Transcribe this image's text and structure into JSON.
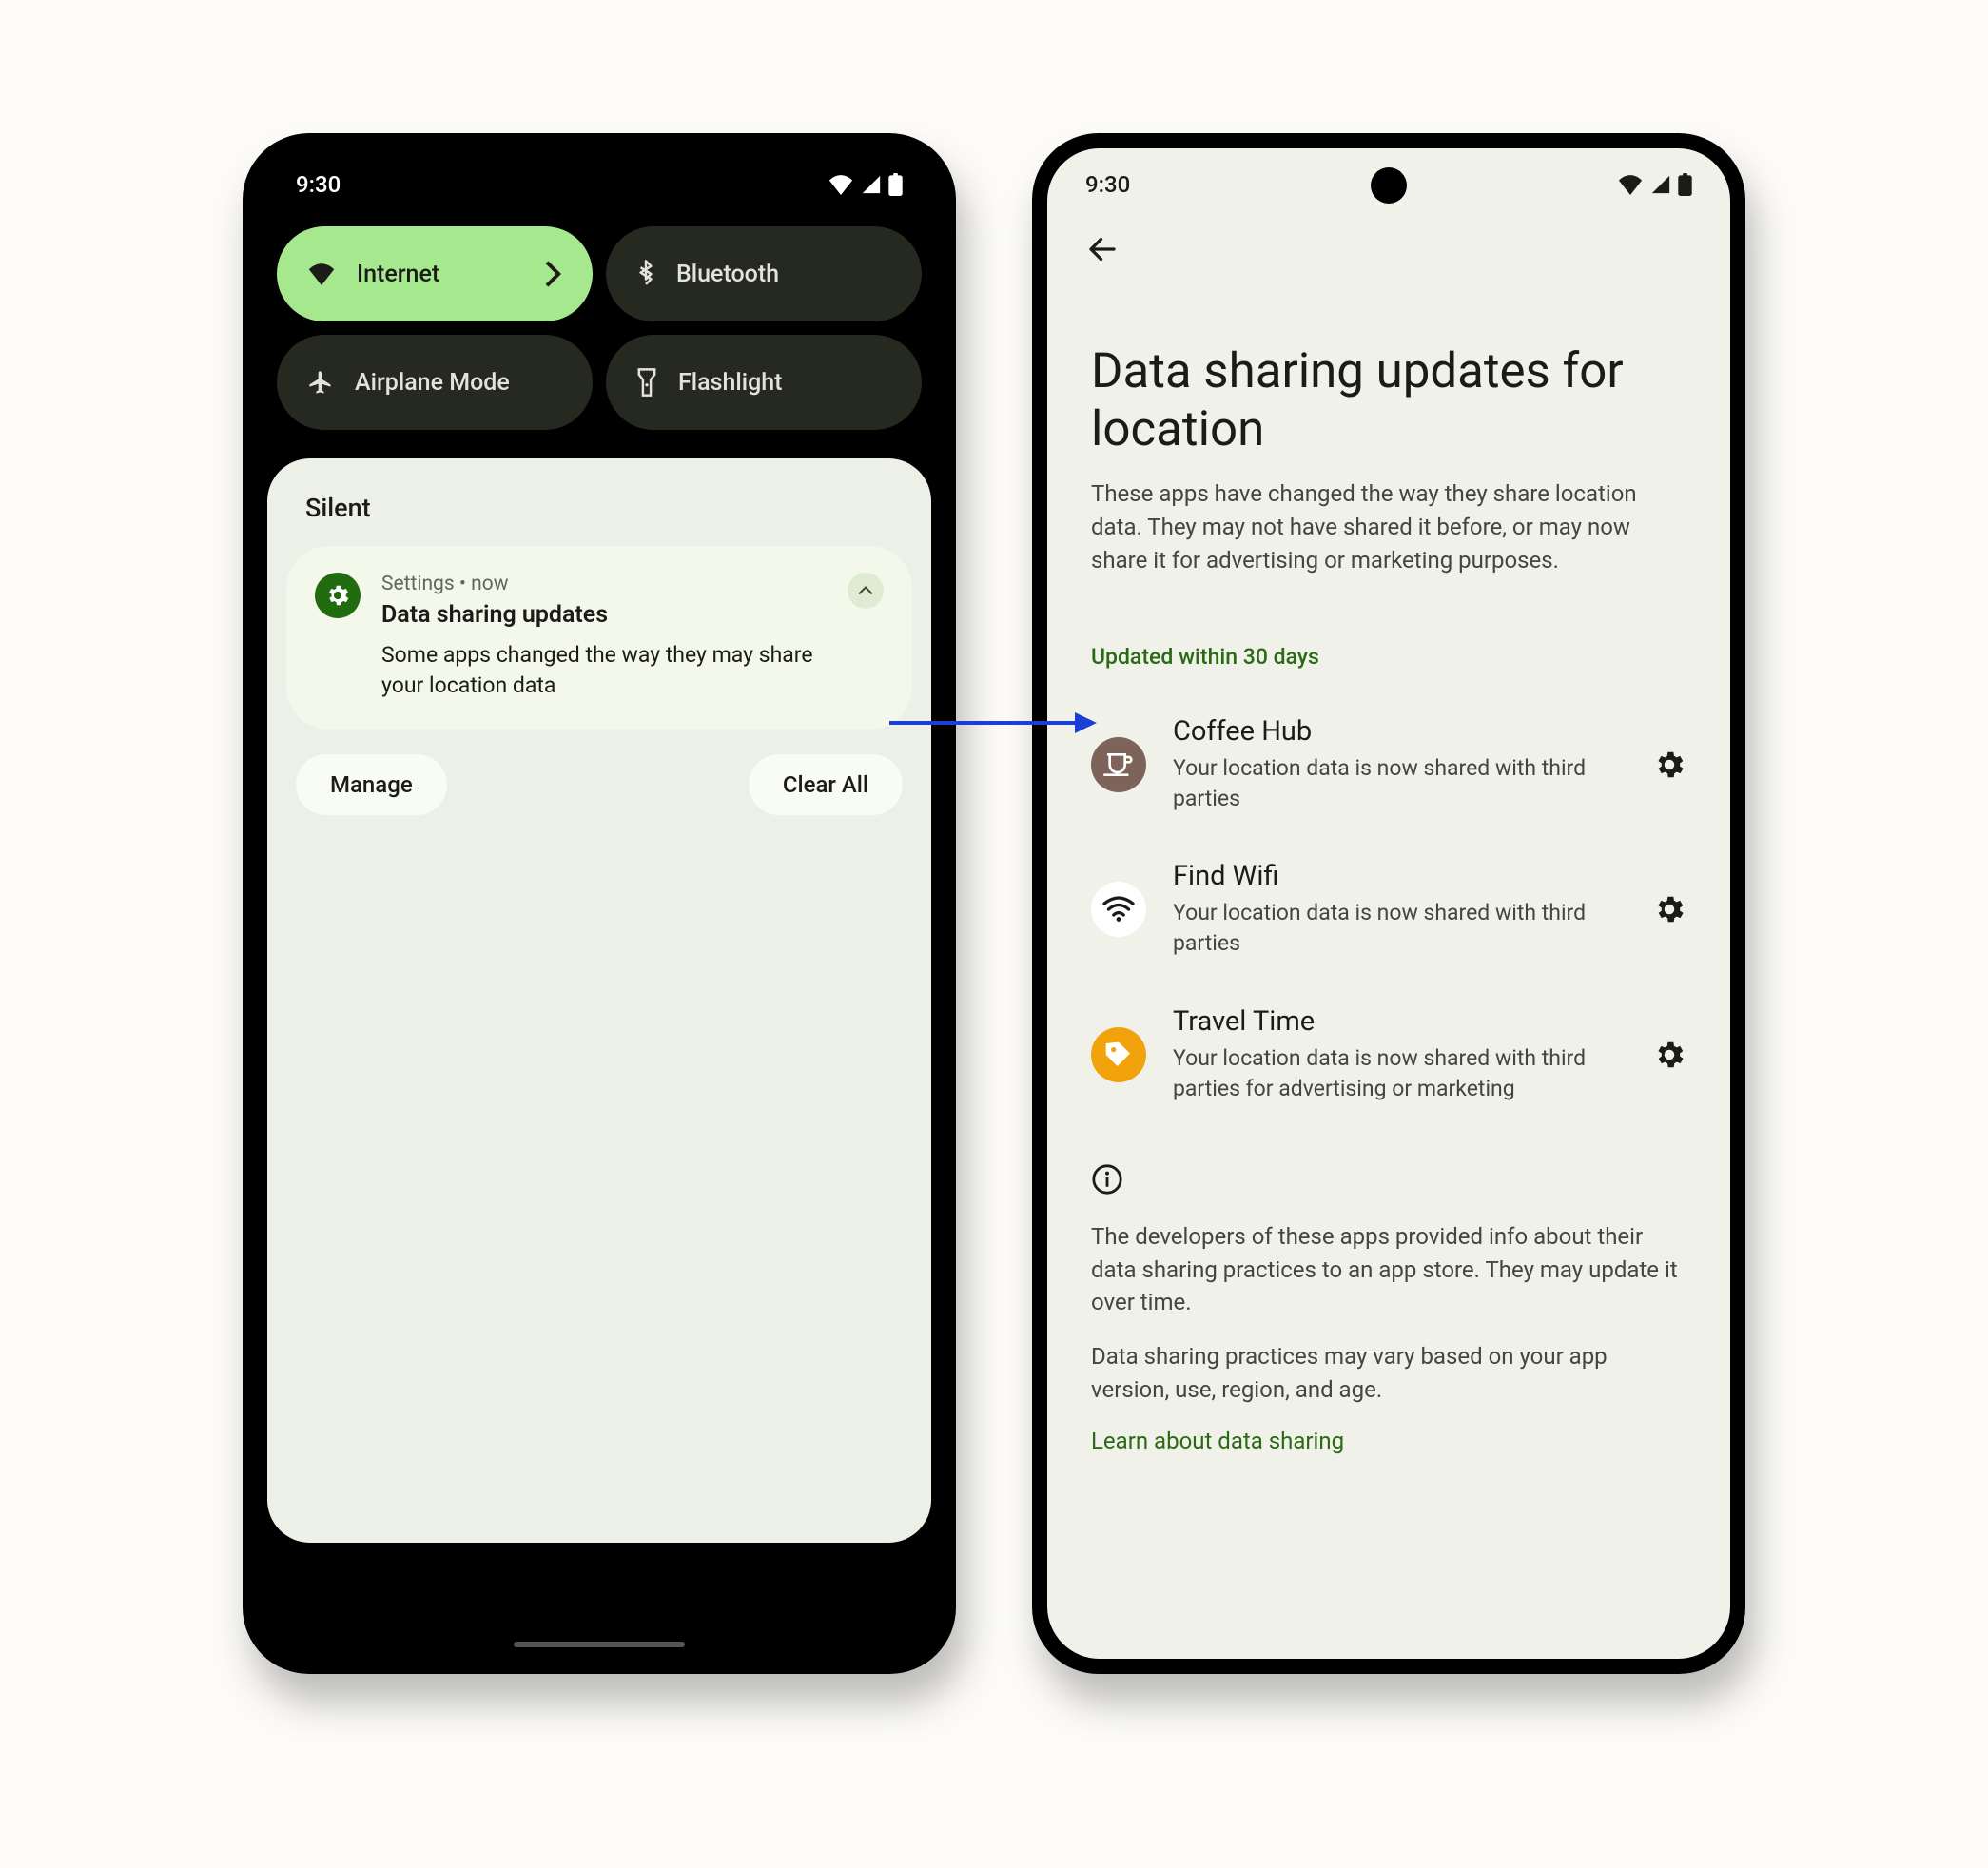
{
  "status": {
    "time": "9:30"
  },
  "left": {
    "tiles": {
      "internet": "Internet",
      "bluetooth": "Bluetooth",
      "airplane": "Airplane Mode",
      "flashlight": "Flashlight"
    },
    "shade": {
      "section": "Silent",
      "notif": {
        "app": "Settings  •  now",
        "title": "Data sharing updates",
        "body": "Some apps changed the way they may share your location data"
      },
      "manage": "Manage",
      "clear": "Clear All"
    }
  },
  "right": {
    "title": "Data sharing updates for location",
    "subtitle": "These apps have changed the way they share location data. They may not have shared it before, or may now share it for advertising or marketing purposes.",
    "section": "Updated within 30 days",
    "apps": {
      "coffee": {
        "name": "Coffee Hub",
        "desc": "Your location data is now shared with third parties"
      },
      "wifi": {
        "name": "Find Wifi",
        "desc": "Your location data is now shared with third parties"
      },
      "travel": {
        "name": "Travel Time",
        "desc": "Your location data is now shared with third parties for advertising or marketing"
      }
    },
    "info1": "The developers of these apps provided info about their data sharing practices to an app store. They may update it over time.",
    "info2": "Data sharing practices may vary based on your app version, use, region, and age.",
    "learn": "Learn about data sharing"
  }
}
